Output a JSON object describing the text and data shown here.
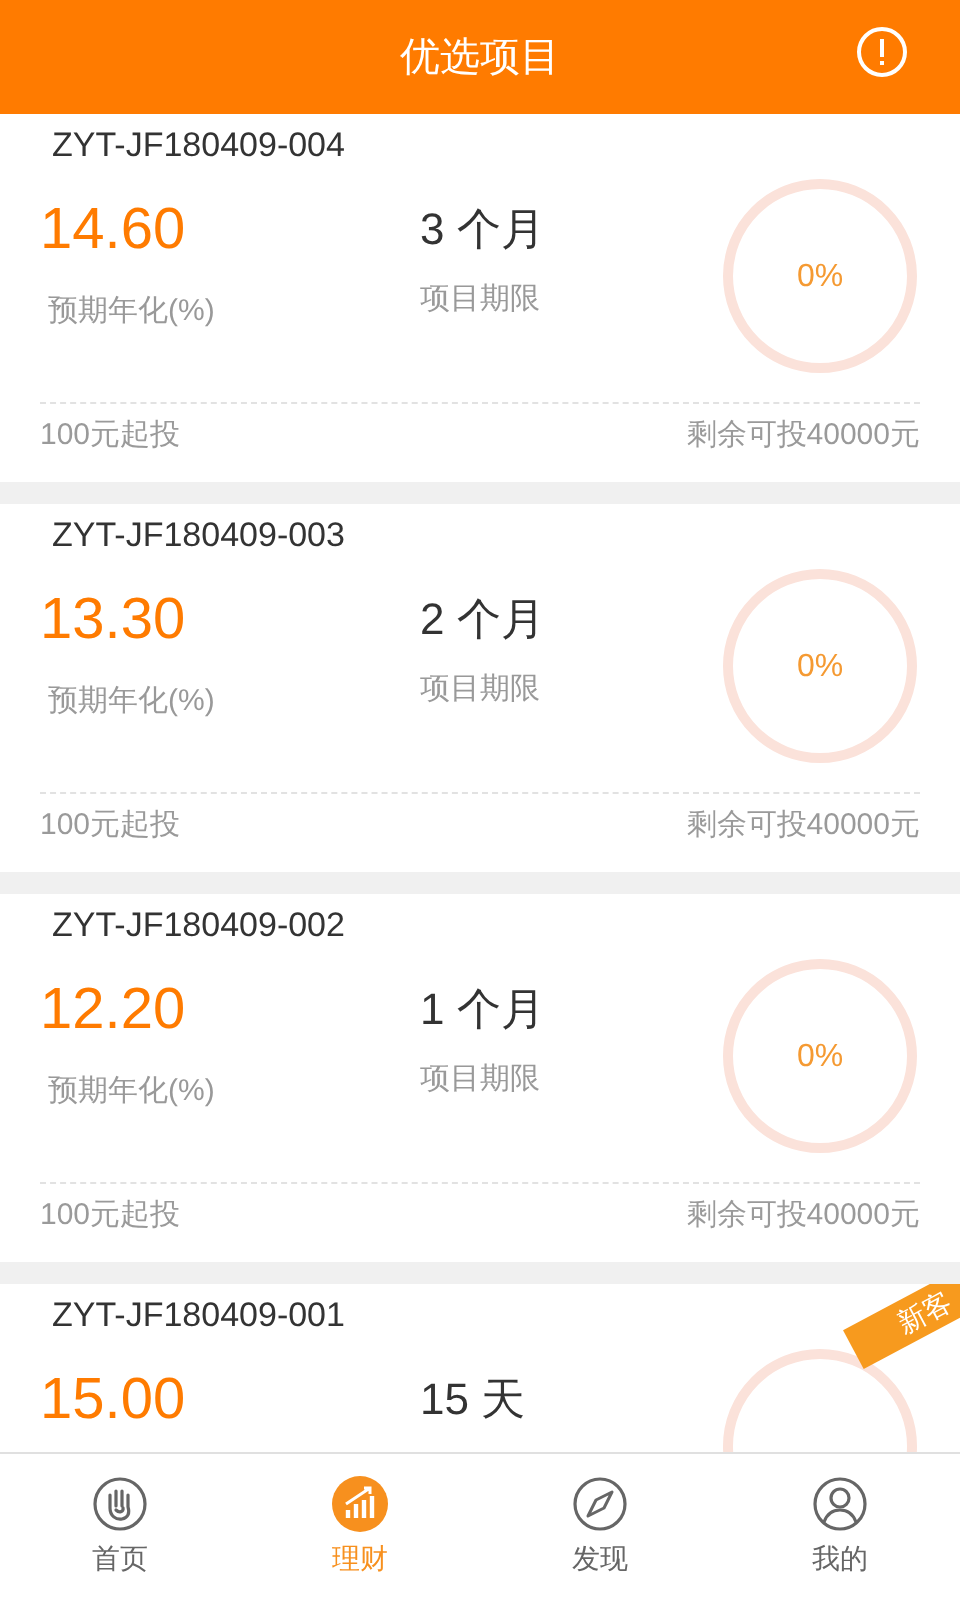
{
  "header": {
    "title": "优选项目"
  },
  "projects": [
    {
      "id": "ZYT-JF180409-004",
      "rate": "14.60",
      "rate_label": "预期年化(%)",
      "term": "3 个月",
      "term_label": "项目期限",
      "percent": "0%",
      "min_invest": "100元起投",
      "remaining": "剩余可投40000元"
    },
    {
      "id": "ZYT-JF180409-003",
      "rate": "13.30",
      "rate_label": "预期年化(%)",
      "term": "2 个月",
      "term_label": "项目期限",
      "percent": "0%",
      "min_invest": "100元起投",
      "remaining": "剩余可投40000元"
    },
    {
      "id": "ZYT-JF180409-002",
      "rate": "12.20",
      "rate_label": "预期年化(%)",
      "term": "1 个月",
      "term_label": "项目期限",
      "percent": "0%",
      "min_invest": "100元起投",
      "remaining": "剩余可投40000元"
    },
    {
      "id": "ZYT-JF180409-001",
      "rate": "15.00",
      "term": "15 天",
      "badge": "新客"
    }
  ],
  "tabs": [
    {
      "label": "首页",
      "kind": "hand",
      "selected": false
    },
    {
      "label": "理财",
      "kind": "chart",
      "selected": true
    },
    {
      "label": "发现",
      "kind": "compass",
      "selected": false
    },
    {
      "label": "我的",
      "kind": "person",
      "selected": false
    }
  ]
}
